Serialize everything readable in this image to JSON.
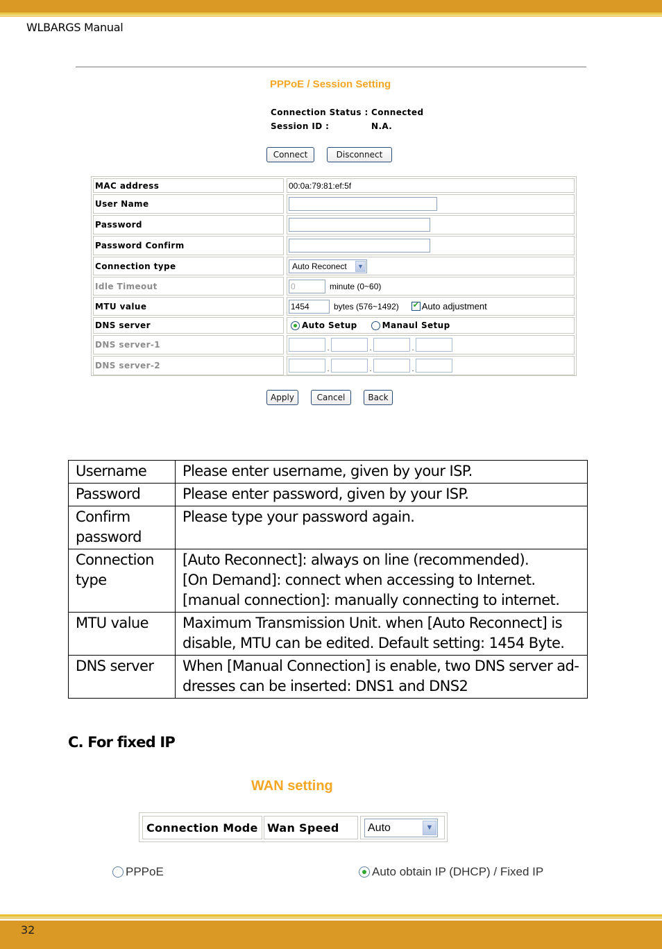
{
  "page": {
    "doc_title": "WLBARGS Manual",
    "page_number": "32"
  },
  "pppoe": {
    "title": "PPPoE / Session Setting",
    "status_label": "Connection Status :",
    "status_value": "Connected",
    "session_label": "Session ID :",
    "session_value": "N.A.",
    "connect_label": "Connect",
    "disconnect_label": "Disconnect",
    "fields": {
      "mac_label": "MAC address",
      "mac_value": "00:0a:79:81:ef:5f",
      "username_label": "User Name",
      "username_value": "",
      "password_label": "Password",
      "password_value": "",
      "password_confirm_label": "Password Confirm",
      "password_confirm_value": "",
      "connection_type_label": "Connection type",
      "connection_type_value": "Auto Reconect",
      "idle_timeout_label": "Idle Timeout",
      "idle_timeout_value": "0",
      "idle_timeout_unit": "minute (0~60)",
      "mtu_label": "MTU value",
      "mtu_value": "1454",
      "mtu_unit": "bytes (576~1492)",
      "auto_adjust_label": "Auto adjustment",
      "auto_adjust_checked": true,
      "dns_label": "DNS server",
      "dns_auto_label": "Auto Setup",
      "dns_manual_label": "Manaul Setup",
      "dns_selected": "auto",
      "dns1_label": "DNS server-1",
      "dns2_label": "DNS server-2"
    },
    "apply_label": "Apply",
    "cancel_label": "Cancel",
    "back_label": "Back"
  },
  "description_table": {
    "rows": [
      {
        "key": "Username",
        "value": "Please enter username, given by your ISP."
      },
      {
        "key": "Password",
        "value": "Please enter password, given by your ISP."
      },
      {
        "key": "Confirm password",
        "value": "Please type your password again."
      },
      {
        "key": "Connection type",
        "value_lines": [
          "[Auto Reconnect]:  always on line (recommended).",
          "[On Demand]: connect when accessing to Internet.",
          "[manual connection]: manually connecting to internet."
        ]
      },
      {
        "key": "MTU value",
        "value": "Maximum Transmission Unit. when [Auto Reconnect] is disable, MTU can be edited. Default setting: 1454 Byte."
      },
      {
        "key": "DNS server",
        "value": "When [Manual Connection] is enable, two DNS server ad-dresses can be inserted: DNS1 and DNS2"
      }
    ]
  },
  "section_c": {
    "heading": "C. For fixed IP"
  },
  "wan": {
    "title": "WAN setting",
    "connection_mode_label": "Connection Mode",
    "wan_speed_label": "Wan Speed",
    "wan_speed_value": "Auto",
    "pppoe_label": "PPPoE",
    "dhcp_label": "Auto obtain IP (DHCP) / Fixed IP",
    "selected": "dhcp"
  },
  "colors": {
    "band": "#da9824",
    "title_orange": "#f5a623"
  }
}
